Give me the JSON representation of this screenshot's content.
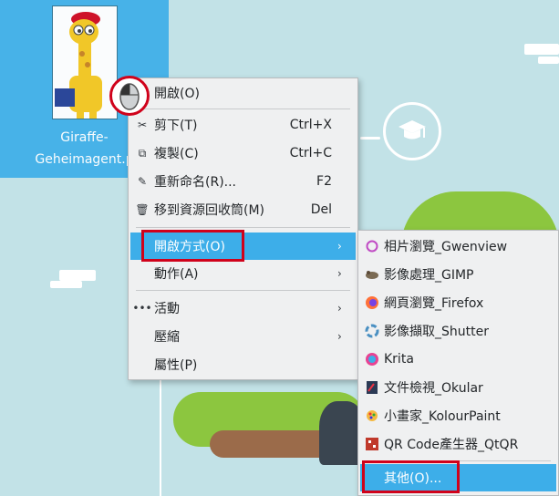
{
  "desktop": {
    "file_icon": {
      "label_line1": "Giraffe-",
      "label_line2": "Geheimagent.p"
    }
  },
  "context_menu": {
    "items": [
      {
        "label": "開啟(O)",
        "shortcut": ""
      },
      {
        "label": "剪下(T)",
        "shortcut": "Ctrl+X"
      },
      {
        "label": "複製(C)",
        "shortcut": "Ctrl+C"
      },
      {
        "label": "重新命名(R)...",
        "shortcut": "F2"
      },
      {
        "label": "移到資源回收筒(M)",
        "shortcut": "Del"
      },
      {
        "label": "開啟方式(O)",
        "shortcut": ""
      },
      {
        "label": "動作(A)",
        "shortcut": ""
      },
      {
        "label": "活動",
        "shortcut": ""
      },
      {
        "label": "壓縮",
        "shortcut": ""
      },
      {
        "label": "屬性(P)",
        "shortcut": ""
      }
    ]
  },
  "open_with_menu": {
    "items": [
      {
        "label": "相片瀏覽_Gwenview",
        "icon": "gwenview-icon"
      },
      {
        "label": "影像處理_GIMP",
        "icon": "gimp-icon"
      },
      {
        "label": "網頁瀏覽_Firefox",
        "icon": "firefox-icon"
      },
      {
        "label": "影像擷取_Shutter",
        "icon": "shutter-icon"
      },
      {
        "label": "Krita",
        "icon": "krita-icon"
      },
      {
        "label": "文件檢視_Okular",
        "icon": "okular-icon"
      },
      {
        "label": "小畫家_KolourPaint",
        "icon": "kolourpaint-icon"
      },
      {
        "label": "QR Code產生器_QtQR",
        "icon": "qtqr-icon"
      },
      {
        "label": "其他(O)...",
        "icon": ""
      }
    ]
  },
  "colors": {
    "highlight": "#3daee9",
    "annotation": "#d0021b"
  }
}
